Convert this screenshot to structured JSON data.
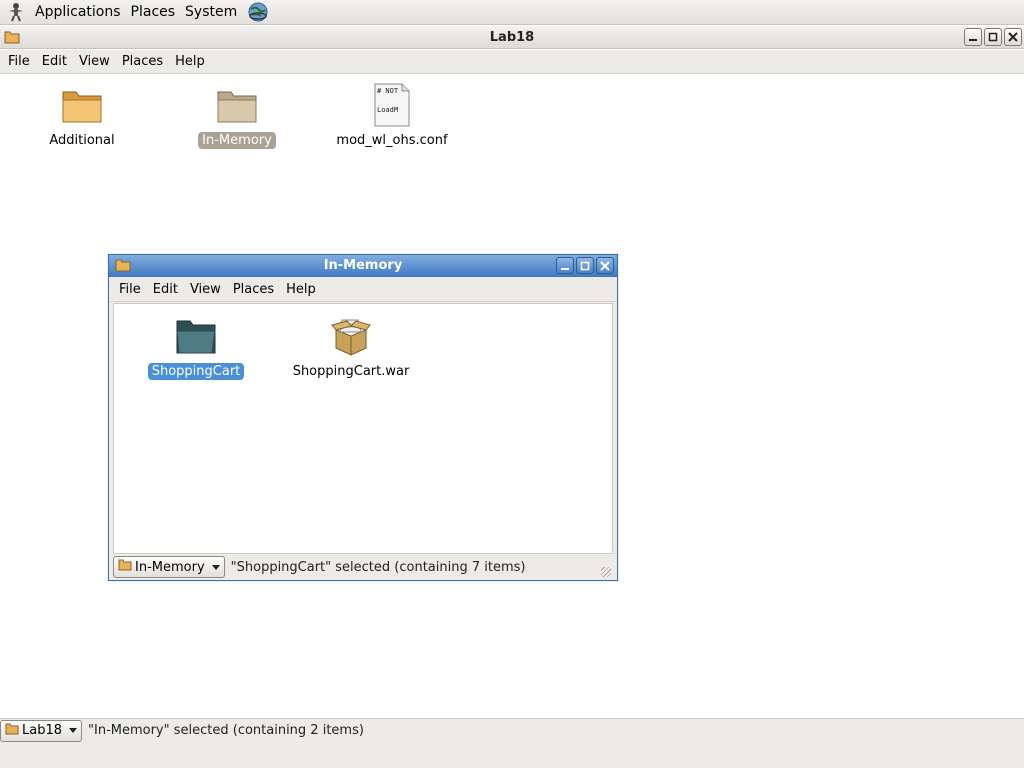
{
  "panel": {
    "menus": [
      "Applications",
      "Places",
      "System"
    ]
  },
  "main_window": {
    "title": "Lab18",
    "menu": [
      "File",
      "Edit",
      "View",
      "Places",
      "Help"
    ],
    "items": [
      {
        "label": "Additional",
        "icon": "folder-icon"
      },
      {
        "label": "In-Memory",
        "icon": "folder-icon",
        "selected": true
      },
      {
        "label": "mod_wl_ohs.conf",
        "icon": "text-file-icon",
        "preview_lines": [
          "# NOT",
          "LoadM"
        ]
      }
    ],
    "location": "Lab18",
    "status": "\"In-Memory\" selected (containing 2 items)"
  },
  "child_window": {
    "title": "In-Memory",
    "menu": [
      "File",
      "Edit",
      "View",
      "Places",
      "Help"
    ],
    "items": [
      {
        "label": "ShoppingCart",
        "icon": "folder-open-icon",
        "selected": true
      },
      {
        "label": "ShoppingCart.war",
        "icon": "archive-package-icon"
      }
    ],
    "location": "In-Memory",
    "status": "\"ShoppingCart\" selected (containing 7 items)"
  },
  "colors": {
    "active_title": "#3f79c2",
    "selection_blue": "#4a90d9",
    "selection_grey": "#aba195",
    "folder": "#e6b25a"
  }
}
